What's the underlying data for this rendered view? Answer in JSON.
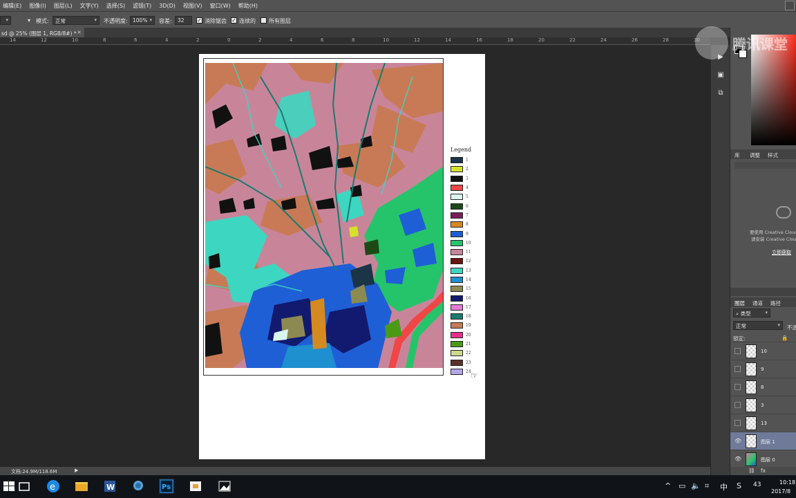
{
  "menu": {
    "items": [
      "编辑(E)",
      "图像(I)",
      "图层(L)",
      "文字(Y)",
      "选择(S)",
      "滤镜(T)",
      "3D(D)",
      "视图(V)",
      "窗口(W)",
      "帮助(H)"
    ]
  },
  "options_bar": {
    "mode_label": "模式:",
    "mode_value": "正常",
    "opacity_label": "不透明度:",
    "opacity_value": "100%",
    "tolerance_label": "容差:",
    "tolerance_value": "32",
    "antialias_label": "消除锯齿",
    "contiguous_label": "连续的",
    "all_layers_label": "所有图层",
    "antialias_checked": true,
    "contiguous_checked": true,
    "all_layers_checked": false
  },
  "document_tab": {
    "title": "sd @ 25% (图层 1, RGB/8#) *",
    "close": "×"
  },
  "ruler": {
    "ticks": [
      "14",
      "12",
      "10",
      "8",
      "6",
      "4",
      "2",
      "0",
      "2",
      "4",
      "6",
      "8",
      "10",
      "12",
      "14",
      "16",
      "18",
      "20",
      "22",
      "24",
      "26",
      "28",
      "30"
    ]
  },
  "legend": {
    "title": "Legend",
    "items": [
      {
        "label": "1",
        "color": "#1b3446"
      },
      {
        "label": "2",
        "color": "#d6e227"
      },
      {
        "label": "3",
        "color": "#111111"
      },
      {
        "label": "4",
        "color": "#f04646"
      },
      {
        "label": "5",
        "color": "#d9f7ee"
      },
      {
        "label": "6",
        "color": "#1c4a17"
      },
      {
        "label": "7",
        "color": "#7a1f57"
      },
      {
        "label": "8",
        "color": "#d48a21"
      },
      {
        "label": "9",
        "color": "#1f5fd6"
      },
      {
        "label": "10",
        "color": "#26c46a"
      },
      {
        "label": "11",
        "color": "#c8859a"
      },
      {
        "label": "12",
        "color": "#6a140f"
      },
      {
        "label": "13",
        "color": "#3dd6c0"
      },
      {
        "label": "14",
        "color": "#1e8fcf"
      },
      {
        "label": "15",
        "color": "#8c8a52"
      },
      {
        "label": "16",
        "color": "#111a6e"
      },
      {
        "label": "17",
        "color": "#e67ad6"
      },
      {
        "label": "18",
        "color": "#1a7a6e"
      },
      {
        "label": "19",
        "color": "#c87a56"
      },
      {
        "label": "20",
        "color": "#e8308a"
      },
      {
        "label": "21",
        "color": "#4a9a18"
      },
      {
        "label": "22",
        "color": "#cdd98a"
      },
      {
        "label": "23",
        "color": "#5a3326"
      },
      {
        "label": "24",
        "color": "#b4a7e8"
      }
    ]
  },
  "status": {
    "doc_size": "文档:24.9M/118.6M",
    "arrow": "▶"
  },
  "panels": {
    "tab_library": "库",
    "tab_adjust": "调整",
    "tab_styles": "样式",
    "lib_msg1": "要使用 Creative Cloud",
    "lib_msg2": "请安装 Creative Cloud",
    "lib_link": "立即获取",
    "tab_layers": "图层",
    "tab_channels": "通道",
    "tab_paths": "路径",
    "kind_label": "类型",
    "blend_value": "正常",
    "opacity_short": "不透",
    "lock_label": "锁定:"
  },
  "layers": [
    {
      "name": "10",
      "visible": false,
      "active": false
    },
    {
      "name": "9",
      "visible": false,
      "active": false
    },
    {
      "name": "8",
      "visible": false,
      "active": false
    },
    {
      "name": "3",
      "visible": false,
      "active": false
    },
    {
      "name": "13",
      "visible": false,
      "active": false
    },
    {
      "name": "图层 1",
      "visible": true,
      "active": true
    },
    {
      "name": "图层 0",
      "visible": true,
      "active": false
    }
  ],
  "watermark": {
    "text": "腾讯课堂"
  },
  "taskbar": {
    "ime": "中",
    "num": "43",
    "time": "10:18",
    "date": "2017/8"
  }
}
